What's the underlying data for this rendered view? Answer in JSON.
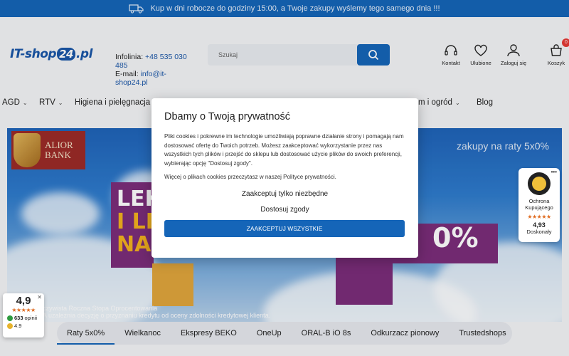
{
  "topbar": {
    "text": "Kup w dni robocze do godziny 15:00, a Twoje zakupy wyślemy tego samego dnia !!!"
  },
  "header": {
    "logo_prefix": "IT-shop",
    "logo_num": "24",
    "logo_suffix": ".pl",
    "contact_phone_label": "Infolinia:",
    "contact_phone": "+48 535 030 485",
    "contact_email_label": "E-mail:",
    "contact_email": "info@it-shop24.pl",
    "search_placeholder": "Szukaj",
    "icons": [
      {
        "label": "Kontakt",
        "icon": "headset-icon"
      },
      {
        "label": "Ulubione",
        "icon": "heart-icon"
      },
      {
        "label": "Zaloguj się",
        "icon": "user-icon"
      },
      {
        "label": "Koszyk",
        "icon": "cart-icon",
        "badge": "0"
      }
    ]
  },
  "nav": {
    "items": [
      "AGD",
      "RTV",
      "Higiena i pielęgnacja",
      "m i ogród",
      "Blog"
    ]
  },
  "banner": {
    "bank_line1": "ALIOR",
    "bank_line2": "BANK",
    "raty_text": "zakupy na raty 5x0%",
    "big_line1": "LEK",
    "big_line2": "I LE",
    "big_line3": "NA",
    "percent": "0%",
    "fine_print1": "czywista Roczna Stopa Oprocentowania",
    "fine_print2": "A uzależnia decyzję o przyznaniu kredytu od oceny zdolności kredytowej klienta."
  },
  "tabs": [
    "Raty 5x0%",
    "Wielkanoc",
    "Ekspresy BEKO",
    "OneUp",
    "ORAL-B iO 8s",
    "Odkurzacz pionowy",
    "Trustedshops"
  ],
  "cookie_modal": {
    "title": "Dbamy o Twoją prywatność",
    "body": "Pliki cookies i pokrewne im technologie umożliwiają poprawne działanie strony i pomagają nam dostosować ofertę do Twoich potrzeb. Możesz zaakceptować wykorzystanie przez nas wszystkich tych plików i przejść do sklepu lub dostosować użycie plików do swoich preferencji, wybierając opcję \"Dostosuj zgody\".",
    "body2": "Więcej o plikach cookies przeczytasz w naszej Polityce prywatności.",
    "only_necessary": "Zaakceptuj tylko niezbędne",
    "customize": "Dostosuj zgody",
    "accept_all": "ZAAKCEPTUJ WSZYSTKIE"
  },
  "trusted_badge": {
    "line1": "Ochrona",
    "line2": "Kupującego",
    "stars": "★★★★★",
    "score": "4,93",
    "label": "Doskonały",
    "more": "•••"
  },
  "rating_widget": {
    "score": "4,9",
    "stars": "★★★★★",
    "count": "633",
    "count_label": "opinii",
    "google_score": "4.9",
    "close": "✕"
  }
}
